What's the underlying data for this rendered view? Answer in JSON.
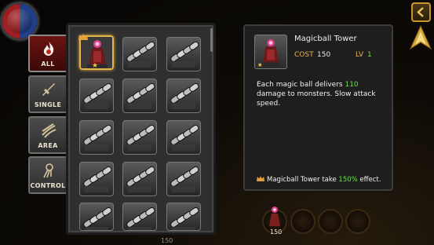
{
  "tabs": [
    {
      "label": "ALL",
      "icon": "flame-icon",
      "active": true
    },
    {
      "label": "SINGLE",
      "icon": "sword-icon",
      "active": false
    },
    {
      "label": "AREA",
      "icon": "claw-icon",
      "active": false
    },
    {
      "label": "CONTROL",
      "icon": "lightning-icon",
      "active": false
    }
  ],
  "grid": {
    "tower_count": 15,
    "selected_item": "magicball-tower",
    "locked_icon": "chain-icon",
    "count_label": "150"
  },
  "info": {
    "title": "Magicball Tower",
    "cost_label": "COST",
    "cost_value": "150",
    "level_label": "LV",
    "level_value": "1",
    "desc_part1": "Each magic ball delivers ",
    "desc_damage": "110",
    "desc_part2": " damage to monsters. Slow attack speed.",
    "bonus_part1": "Magicball Tower take ",
    "bonus_value": "150%",
    "bonus_part2": " effect."
  },
  "bottom_bar": {
    "slot_cost": "150"
  },
  "colors": {
    "accent_gold": "#e6b44a",
    "value_green": "#6ee04c",
    "active_tab": "#6b1412"
  }
}
